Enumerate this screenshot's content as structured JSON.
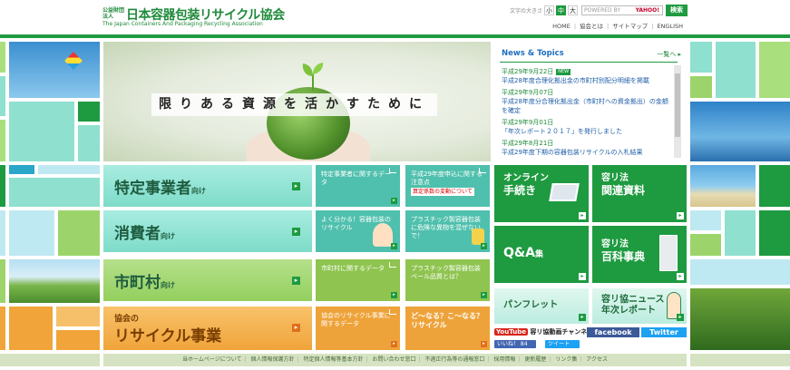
{
  "header": {
    "logo_corp": "公益財団法人",
    "logo_name": "日本容器包装リサイクル協会",
    "logo_en": "The Japan Containers And Packaging Recycling Association",
    "fontsize_label": "文字の大きさ",
    "fontsize_options": [
      "小",
      "中",
      "大"
    ],
    "search_brand": "YAHOO!",
    "search_powered": "POWERED BY",
    "search_button": "検索",
    "nav": [
      "HOME",
      "協会とは",
      "サイトマップ",
      "ENGLISH"
    ]
  },
  "hero": {
    "copy": "限りある資源を活かすために"
  },
  "news": {
    "title": "News & Topics",
    "more": "一覧へ",
    "items": [
      {
        "date": "平成29年9月22日",
        "new": "NEW",
        "text": "平成28年度合理化拠出金の市町村別配分明細を掲載"
      },
      {
        "date": "平成29年9月07日",
        "new": "",
        "text": "平成28年度分合理化拠出金（市町村への資金拠出）の金額を確定"
      },
      {
        "date": "平成29年9月01日",
        "new": "",
        "text": "「年次レポート２０１７」を発行しました"
      },
      {
        "date": "平成29年8月21日",
        "new": "",
        "text": "平成29年度下期の容器包装リサイクルの入札結果"
      }
    ]
  },
  "categories": [
    {
      "label": "特定事業者",
      "suffix": "向け"
    },
    {
      "label": "消費者",
      "suffix": "向け"
    },
    {
      "label": "市町村",
      "suffix": "向け"
    },
    {
      "label_small": "協会の",
      "label": "リサイクル事業"
    }
  ],
  "info_tiles": {
    "business_data": "特定事業者に関するデータ",
    "notice": "平成29年度申込に関する注意点",
    "notice_badge": "算定係数の変動について",
    "learn": "よく分かる！容器包装のリサイクル",
    "plastic_foreign": "プラスチック製容器包装に危険な異物を混ぜないで！",
    "municipal_data": "市町村に関するデータ",
    "bale_quality": "プラスチック製容器包装ベール品質とは？",
    "recycle_data": "協会のリサイクル事業に関するデータ",
    "what_next": "ど～なる？こ～なる？リサイクル"
  },
  "big_tiles": {
    "online": [
      "オンライン",
      "手続き"
    ],
    "law_docs": [
      "容リ法",
      "関連資料"
    ],
    "qa": [
      "Q&A",
      "集"
    ],
    "encyclopedia": [
      "容リ法",
      "百科事典"
    ]
  },
  "light_tiles": {
    "pamphlet": "パンフレット",
    "news_report": [
      "容リ協ニュース",
      "年次レポート"
    ]
  },
  "social": {
    "youtube_brand": "YouTube",
    "youtube_label": "容リ協動画チャンネル",
    "facebook": "facebook",
    "twitter": "Twitter",
    "like": "いいね！ 84",
    "tweet": "ツイート"
  },
  "footer": {
    "links": [
      "当ホームページについて",
      "個人情報保護方針",
      "特定個人情報等基本方針",
      "お問い合わせ窓口",
      "不適正行為等の通報窓口",
      "採用情報",
      "更新履歴",
      "リンク集",
      "アクセス"
    ]
  },
  "colors": {
    "brand_green": "#1e9a40",
    "mint": "#7edcc9",
    "light_green": "#9cd46b",
    "olive": "#9dbd3c",
    "orange": "#f0a43a"
  }
}
